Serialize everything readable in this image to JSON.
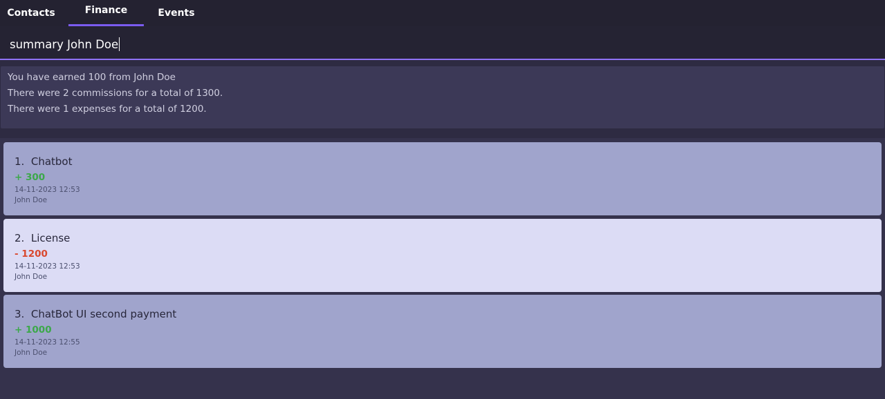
{
  "tabs": [
    {
      "label": "Contacts"
    },
    {
      "label": "Finance"
    },
    {
      "label": "Events"
    }
  ],
  "active_tab": "Finance",
  "command": {
    "value": "summary John Doe"
  },
  "result": {
    "lines": [
      "You have earned 100 from John Doe",
      "There were 2 commissions for a total of 1300.",
      "There were 1 expenses for a total of 1200."
    ]
  },
  "entries": [
    {
      "index": "1.",
      "title": "Chatbot",
      "amount": "+ 300",
      "type": "commission",
      "time": "14-11-2023 12:53",
      "person": "John Doe"
    },
    {
      "index": "2.",
      "title": "License",
      "amount": "- 1200",
      "type": "expense",
      "time": "14-11-2023 12:53",
      "person": "John Doe"
    },
    {
      "index": "3.",
      "title": "ChatBot UI second payment",
      "amount": "+ 1000",
      "type": "commission",
      "time": "14-11-2023 12:55",
      "person": "John Doe"
    }
  ],
  "colors": {
    "accent": "#7b5cf0",
    "positive": "#3ca84a",
    "negative": "#d9482e",
    "card_default": "#a0a4cc",
    "card_selected": "#dcdcf5"
  },
  "selected_entry": 2
}
